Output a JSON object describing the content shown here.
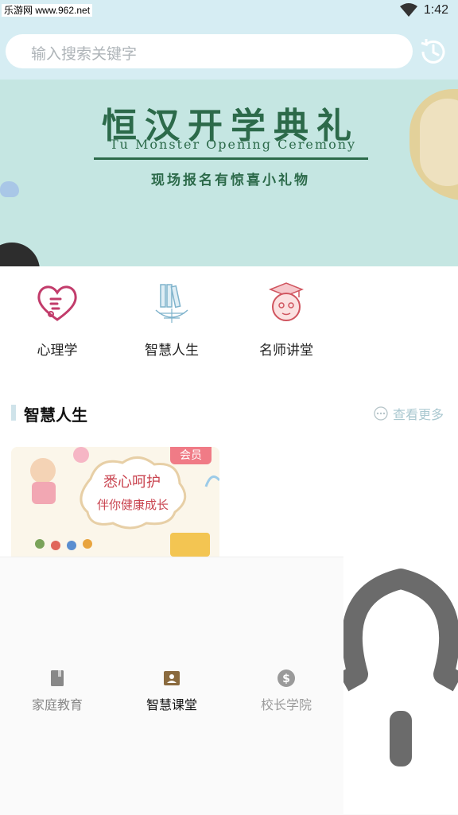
{
  "status": {
    "watermark": "乐游网 www.962.net",
    "time": "1:42"
  },
  "search": {
    "placeholder": "输入搜索关键字"
  },
  "banner": {
    "title": "恒汉开学典礼",
    "subtitle": "Tu Monster Opening Ceremony",
    "tagline": "现场报名有惊喜小礼物"
  },
  "categories": [
    {
      "label": "心理学",
      "icon": "heart-stethoscope-icon"
    },
    {
      "label": "智慧人生",
      "icon": "books-globe-icon"
    },
    {
      "label": "名师讲堂",
      "icon": "teacher-avatar-icon"
    }
  ],
  "section": {
    "title": "智慧人生",
    "more": "查看更多"
  },
  "card": {
    "badge": "会员",
    "caption_line1": "悉心呵护",
    "caption_line2": "伴你健康成长"
  },
  "tabs": [
    {
      "label": "家庭教育",
      "icon": "book-icon",
      "color": "#888888"
    },
    {
      "label": "智慧课堂",
      "icon": "profile-card-icon",
      "color": "#111111"
    },
    {
      "label": "校长学院",
      "icon": "dollar-coin-icon",
      "color": "#9a9a9a"
    }
  ],
  "colors": {
    "header_bg": "#d6edf3",
    "banner_bg": "#c5e6e2",
    "banner_text": "#2c6a4a",
    "accent_pink": "#f07b86"
  }
}
